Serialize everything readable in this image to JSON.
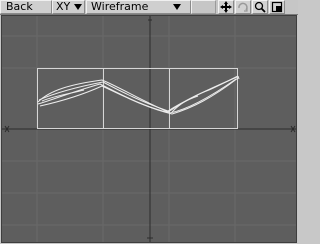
{
  "toolbar": {
    "view_label": "Back",
    "axis_label": "XY",
    "render_mode_label": "Wireframe",
    "icons": [
      "move-view-icon",
      "rotate-view-icon",
      "zoom-view-icon",
      "maximize-view-icon"
    ]
  },
  "viewport": {
    "background_color": "#5e5e5e",
    "grid_color": "#676767",
    "axis_color": "#2a2a2a",
    "bounding_box_color": "#d8d8d8",
    "wire_color": "#e8e8e8"
  }
}
